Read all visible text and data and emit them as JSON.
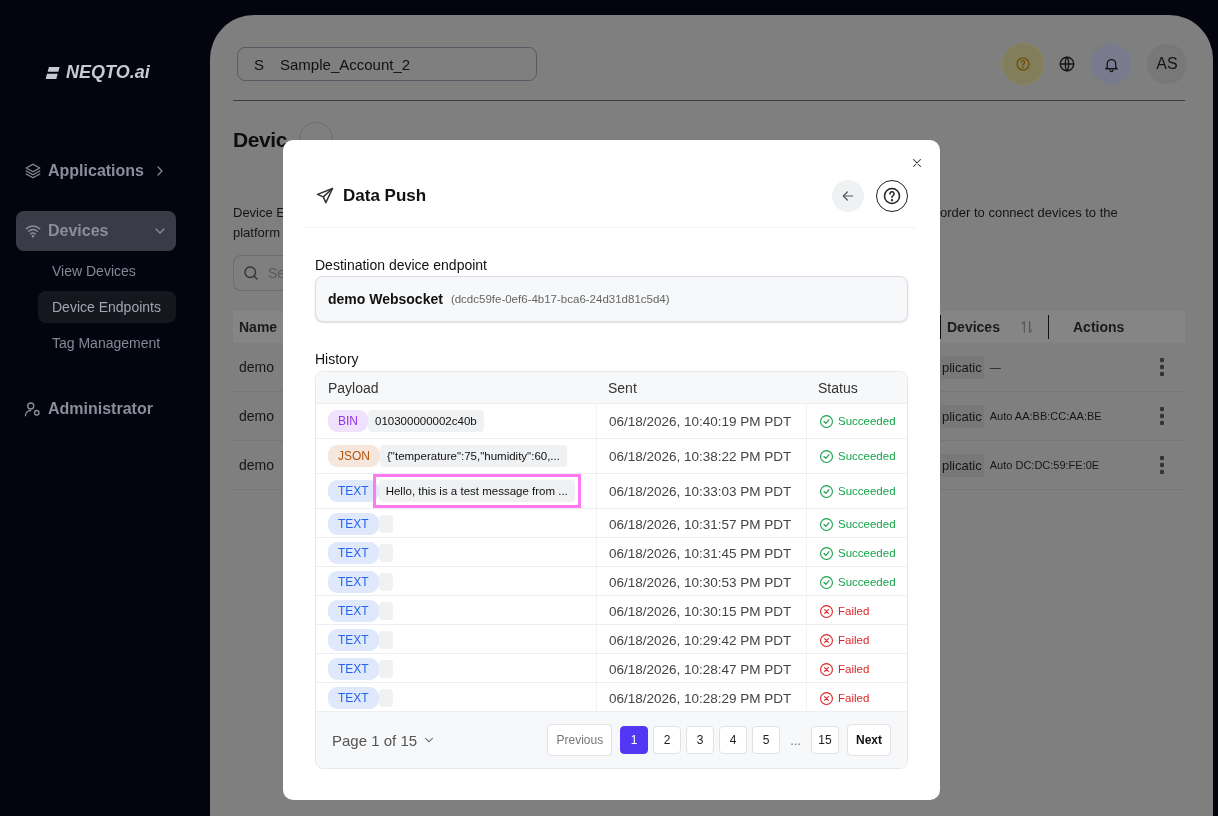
{
  "sidebar": {
    "logo": "NEQTO.ai",
    "items": [
      {
        "label": "Applications",
        "kind": "group",
        "expanded": false,
        "selected": false
      },
      {
        "label": "Devices",
        "kind": "group",
        "expanded": true,
        "selected": true,
        "children": [
          {
            "label": "View Devices",
            "selected": false
          },
          {
            "label": "Device Endpoints",
            "selected": true
          },
          {
            "label": "Tag Management",
            "selected": false
          }
        ]
      },
      {
        "label": "Administrator",
        "kind": "link",
        "selected": false
      }
    ]
  },
  "top_bar": {
    "account": {
      "initial": "S",
      "name": "Sample_Account_2"
    },
    "avatar": "AS"
  },
  "page": {
    "title": "Devic",
    "description_left": [
      "Device E",
      "platform"
    ],
    "description_right": "order to connect devices to the",
    "search_placeholder": "Se",
    "table": {
      "column_1": "Name",
      "column_devices": "Devices",
      "column_actions": "Actions",
      "rows": [
        {
          "column_1": "demo",
          "column_2": "plicatic",
          "devices": "—"
        },
        {
          "column_1": "demo",
          "column_2": "plicatic",
          "devices": "Auto AA:BB:CC:AA:BE"
        },
        {
          "column_1": "demo",
          "column_2": "plicatic",
          "devices": "Auto DC:DC:59:FE:0E"
        }
      ]
    }
  },
  "modal": {
    "title": "Data Push",
    "destination_label": "Destination device endpoint",
    "endpoint": {
      "name": "demo Websocket",
      "id": "(dcdc59fe-0ef6-4b17-bca6-24d31d81c5d4)"
    },
    "history_label": "History",
    "columns": [
      "Payload",
      "Sent",
      "Status"
    ],
    "rows": [
      {
        "type": "BIN",
        "color": "#9333ea",
        "payload": "010300000002c40b",
        "sent": "06/18/2026, 10:40:19 PM PDT",
        "status": "Succeeded",
        "kind": "success",
        "highlighted": false
      },
      {
        "type": "JSON",
        "color": "#b45309",
        "payload": "{\"temperature\":75,\"humidity\":60,...",
        "sent": "06/18/2026, 10:38:22 PM PDT",
        "status": "Succeeded",
        "kind": "success",
        "highlighted": false
      },
      {
        "type": "TEXT",
        "color": "#2563eb",
        "payload": "Hello, this is a test message from ...",
        "sent": "06/18/2026, 10:33:03 PM PDT",
        "status": "Succeeded",
        "kind": "success",
        "highlighted": true
      },
      {
        "type": "TEXT",
        "color": "#2563eb",
        "sent": "06/18/2026, 10:31:57 PM PDT",
        "status": "Succeeded",
        "kind": "success",
        "highlighted": false
      },
      {
        "type": "TEXT",
        "color": "#2563eb",
        "sent": "06/18/2026, 10:31:45 PM PDT",
        "status": "Succeeded",
        "kind": "success",
        "highlighted": false
      },
      {
        "type": "TEXT",
        "color": "#2563eb",
        "sent": "06/18/2026, 10:30:53 PM PDT",
        "status": "Succeeded",
        "kind": "success",
        "highlighted": false
      },
      {
        "type": "TEXT",
        "color": "#2563eb",
        "sent": "06/18/2026, 10:30:15 PM PDT",
        "status": "Failed",
        "kind": "failed",
        "highlighted": false
      },
      {
        "type": "TEXT",
        "color": "#2563eb",
        "sent": "06/18/2026, 10:29:42 PM PDT",
        "status": "Failed",
        "kind": "failed",
        "highlighted": false
      },
      {
        "type": "TEXT",
        "color": "#2563eb",
        "sent": "06/18/2026, 10:28:47 PM PDT",
        "status": "Failed",
        "kind": "failed",
        "highlighted": false
      },
      {
        "type": "TEXT",
        "color": "#2563eb",
        "sent": "06/18/2026, 10:28:29 PM PDT",
        "status": "Failed",
        "kind": "failed",
        "highlighted": false
      }
    ],
    "pagination": {
      "page_label": "Page 1 of 15",
      "previous": {
        "label": "Previous",
        "disabled": true
      },
      "pages": [
        {
          "label": "1",
          "selected": true
        },
        {
          "label": "2",
          "selected": false
        },
        {
          "label": "3",
          "selected": false
        },
        {
          "label": "4",
          "selected": false
        },
        {
          "label": "5",
          "selected": false
        }
      ],
      "ellipsis": "...",
      "last_page": {
        "label": "15",
        "selected": false
      },
      "next": {
        "label": "Next",
        "disabled": false
      }
    }
  }
}
